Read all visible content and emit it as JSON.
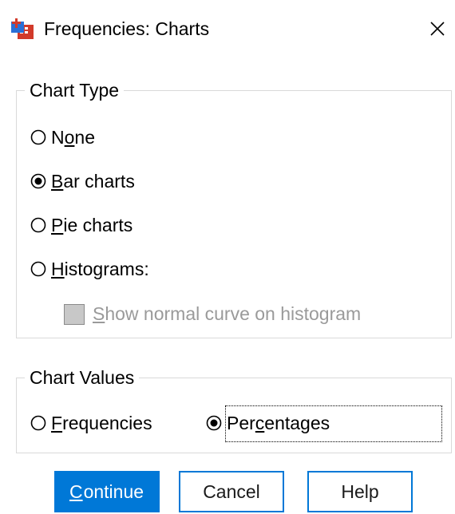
{
  "window": {
    "title": "Frequencies: Charts",
    "close_glyph": "✕"
  },
  "chart_type": {
    "legend": "Chart Type",
    "options": [
      {
        "pre": "N",
        "key": "o",
        "post": "ne",
        "selected": false
      },
      {
        "pre": "",
        "key": "B",
        "post": "ar charts",
        "selected": true
      },
      {
        "pre": "",
        "key": "P",
        "post": "ie charts",
        "selected": false
      },
      {
        "pre": "",
        "key": "H",
        "post": "istograms:",
        "selected": false
      }
    ],
    "normal_curve": {
      "pre": "",
      "key": "S",
      "post": "how normal curve on histogram",
      "checked": false,
      "enabled": false
    }
  },
  "chart_values": {
    "legend": "Chart Values",
    "frequencies": {
      "pre": "",
      "key": "F",
      "post": "requencies",
      "selected": false
    },
    "percentages": {
      "pre": "Per",
      "key": "c",
      "post": "entages",
      "selected": true
    }
  },
  "buttons": {
    "continue": {
      "key": "C",
      "post": "ontinue"
    },
    "cancel": "Cancel",
    "help": "Help"
  },
  "colors": {
    "accent": "#0078d7",
    "disabled_text": "#9a9a9a",
    "group_border": "#d9d9d9"
  }
}
